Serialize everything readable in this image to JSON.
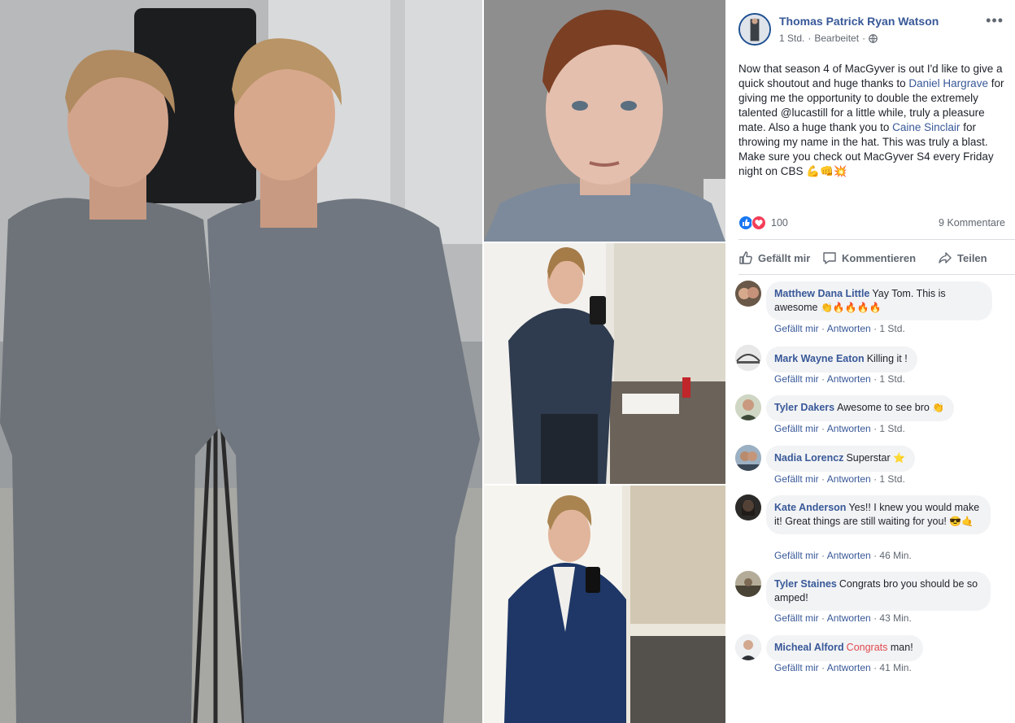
{
  "post": {
    "author": "Thomas Patrick Ryan Watson",
    "time": "1 Std.",
    "edited": "Bearbeitet",
    "sep": "·",
    "text_1": "Now that season 4 of MacGyver is out I'd like to give a quick shoutout and huge thanks to ",
    "mention_1": "Daniel Hargrave",
    "text_2": " for giving me the opportunity to double the extremely talented @lucastill for a little while, truly a pleasure mate. Also a huge thank you to ",
    "mention_2": "Caine Sinclair",
    "text_3": " for throwing my name in the hat. This was truly a blast. Make sure you check out MacGyver S4 every Friday night on CBS ",
    "text_emoji": "💪👊💥",
    "reaction_count": "100",
    "comment_count": "9 Kommentare"
  },
  "actions": {
    "like": "Gefällt mir",
    "comment": "Kommentieren",
    "share": "Teilen"
  },
  "comment_actions": {
    "like": "Gefällt mir",
    "reply": "Antworten",
    "sep": "·"
  },
  "comments": [
    {
      "name": "Matthew Dana Little",
      "text": "Yay Tom. This is awesome ",
      "emoji": "👏🔥🔥🔥🔥",
      "time": "1 Std."
    },
    {
      "name": "Mark Wayne Eaton",
      "text": "Killing it !",
      "time": "1 Std."
    },
    {
      "name": "Tyler Dakers",
      "text": "Awesome to see bro ",
      "emoji": "👏",
      "time": "1 Std."
    },
    {
      "name": "Nadia Lorencz",
      "text": "Superstar ",
      "emoji": "⭐",
      "time": "1 Std."
    },
    {
      "name": "Kate Anderson",
      "text": "Yes!! I knew you would make it! Great things are still waiting for you! ",
      "emoji": "😎🤙",
      "time": "46 Min."
    },
    {
      "name": "Tyler Staines",
      "text": "Congrats bro you should be so amped!",
      "time": "43 Min."
    },
    {
      "name": "Micheal Alford",
      "text_link": "Congrats",
      "text": " man!",
      "time": "41 Min."
    }
  ],
  "colors": {
    "link": "#385898",
    "meta": "#606770",
    "bubble": "#f2f3f5",
    "divider": "#dadde1",
    "like_blue": "#1877f2",
    "love_red": "#f33e58"
  }
}
